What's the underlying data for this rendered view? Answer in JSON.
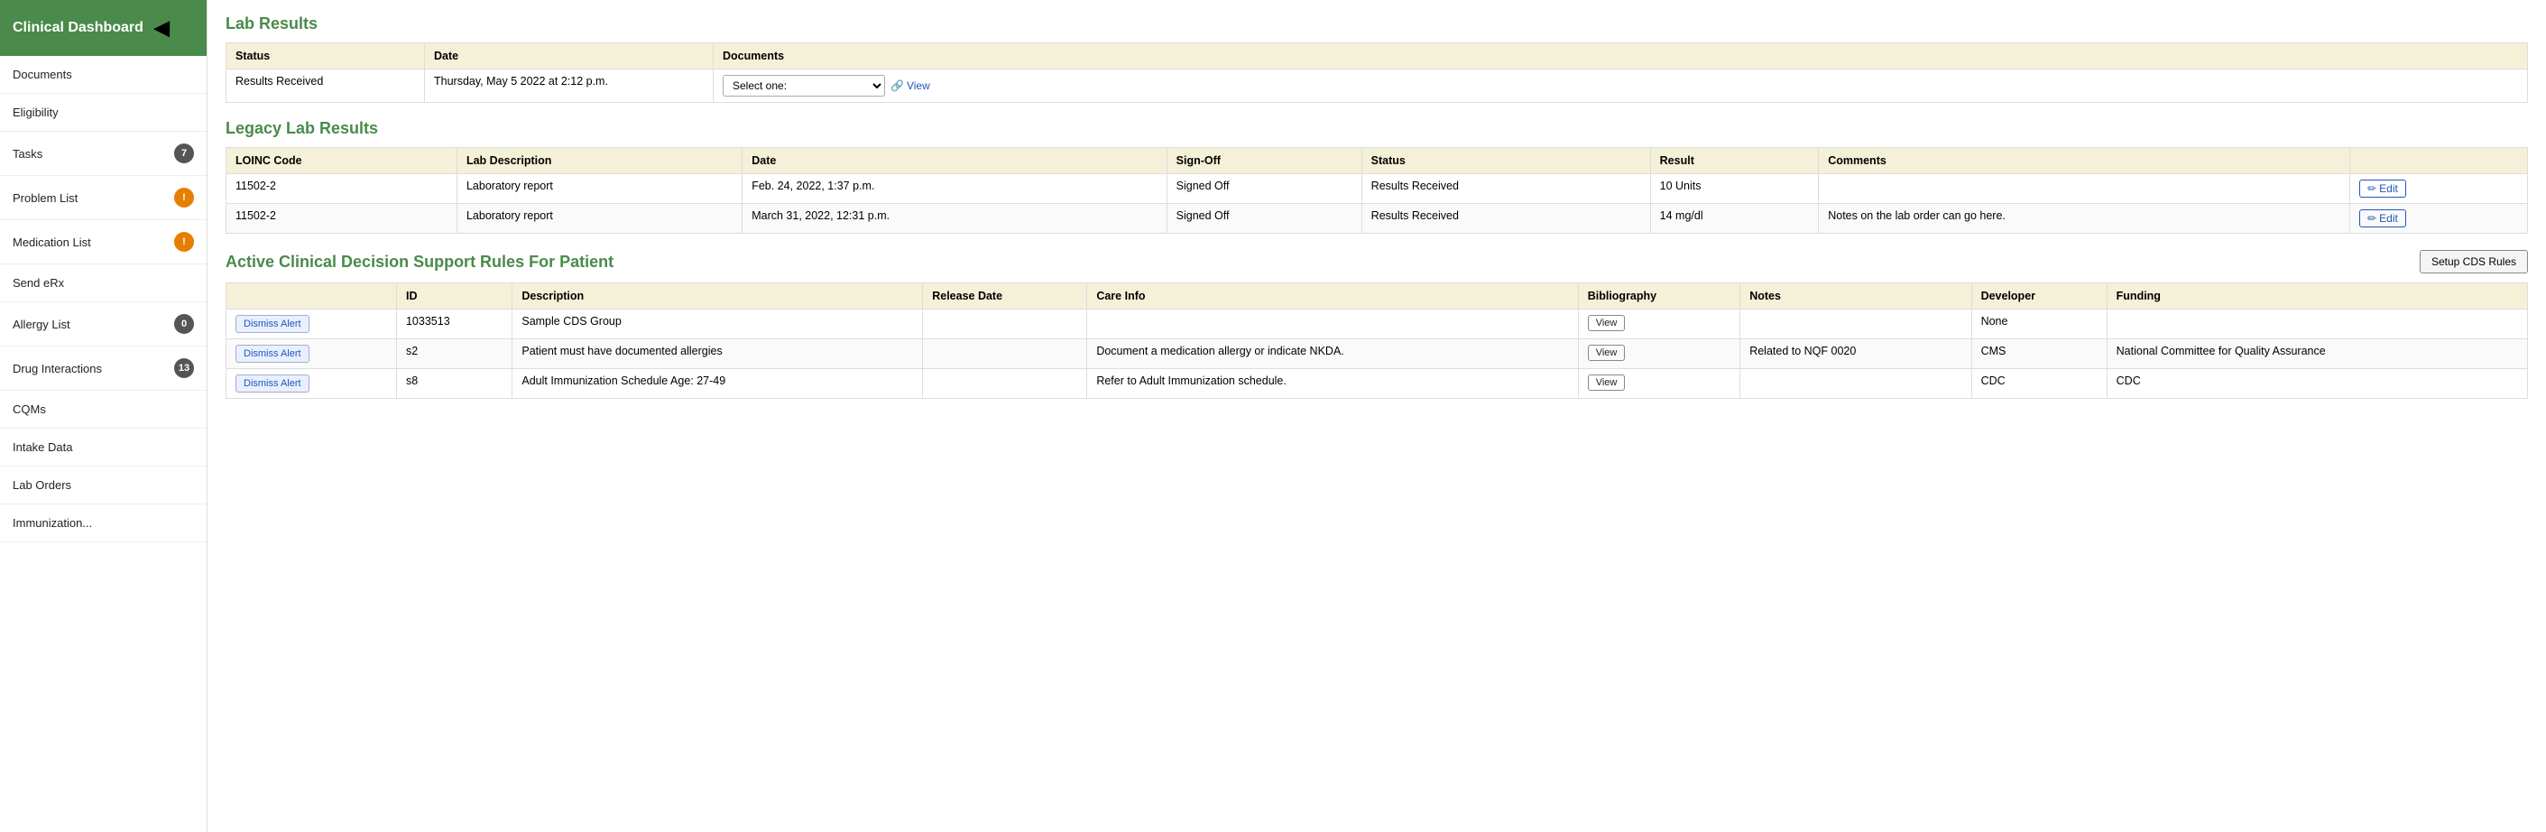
{
  "sidebar": {
    "header": "Clinical Dashboard",
    "items": [
      {
        "label": "Documents",
        "badge": null
      },
      {
        "label": "Eligibility",
        "badge": null
      },
      {
        "label": "Tasks",
        "badge": {
          "count": "7",
          "type": "gray"
        }
      },
      {
        "label": "Problem List",
        "badge": {
          "count": "!",
          "type": "orange"
        }
      },
      {
        "label": "Medication List",
        "badge": {
          "count": "!",
          "type": "orange"
        }
      },
      {
        "label": "Send eRx",
        "badge": null
      },
      {
        "label": "Allergy List",
        "badge": {
          "count": "0",
          "type": "gray"
        }
      },
      {
        "label": "Drug Interactions",
        "badge": {
          "count": "13",
          "type": "gray"
        }
      },
      {
        "label": "CQMs",
        "badge": null
      },
      {
        "label": "Intake Data",
        "badge": null
      },
      {
        "label": "Lab Orders",
        "badge": null
      },
      {
        "label": "Immunization...",
        "badge": null
      }
    ]
  },
  "lab_results": {
    "section_title": "Lab Results",
    "table_headers": [
      "Status",
      "Date",
      "Documents"
    ],
    "rows": [
      {
        "status": "Results Received",
        "date": "Thursday, May 5 2022 at 2:12 p.m.",
        "documents_select": "Select one:",
        "documents_view": "View"
      }
    ]
  },
  "legacy_lab_results": {
    "section_title": "Legacy Lab Results",
    "table_headers": [
      "LOINC Code",
      "Lab Description",
      "Date",
      "Sign-Off",
      "Status",
      "Result",
      "Comments",
      ""
    ],
    "rows": [
      {
        "loinc": "11502-2",
        "description": "Laboratory report",
        "date": "Feb. 24, 2022, 1:37 p.m.",
        "signoff": "Signed Off",
        "status": "Results Received",
        "result": "10 Units",
        "comments": "",
        "edit": "Edit"
      },
      {
        "loinc": "11502-2",
        "description": "Laboratory report",
        "date": "March 31, 2022, 12:31 p.m.",
        "signoff": "Signed Off",
        "status": "Results Received",
        "result": "14 mg/dl",
        "comments": "Notes on the lab order can go here.",
        "edit": "Edit"
      }
    ]
  },
  "cds": {
    "section_title": "Active Clinical Decision Support Rules For Patient",
    "setup_btn": "Setup CDS Rules",
    "table_headers": [
      "",
      "ID",
      "Description",
      "Release Date",
      "Care Info",
      "Bibliography",
      "Notes",
      "Developer",
      "Funding"
    ],
    "rows": [
      {
        "dismiss": "Dismiss Alert",
        "id": "1033513",
        "description": "Sample CDS Group",
        "release_date": "",
        "care_info": "",
        "bibliography": "View",
        "notes": "",
        "developer": "None",
        "funding": ""
      },
      {
        "dismiss": "Dismiss Alert",
        "id": "s2",
        "description": "Patient must have documented allergies",
        "release_date": "",
        "care_info": "Document a medication allergy or indicate NKDA.",
        "bibliography": "View",
        "notes": "Related to NQF 0020",
        "developer": "CMS",
        "funding": "National Committee for Quality Assurance"
      },
      {
        "dismiss": "Dismiss Alert",
        "id": "s8",
        "description": "Adult Immunization Schedule Age: 27-49",
        "release_date": "",
        "care_info": "Refer to Adult Immunization schedule.",
        "bibliography": "View",
        "notes": "",
        "developer": "CDC",
        "funding": "CDC"
      }
    ]
  }
}
